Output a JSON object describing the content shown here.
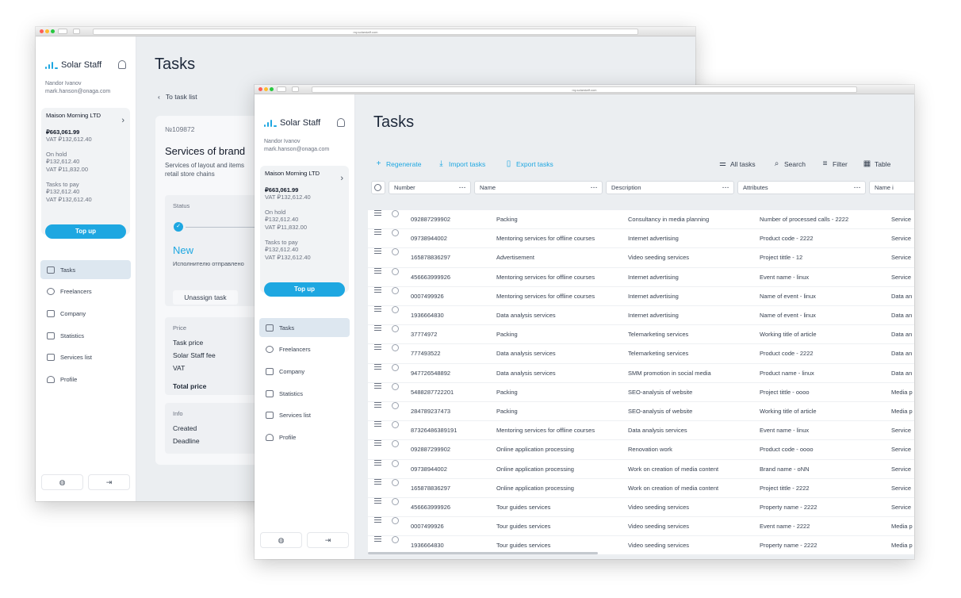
{
  "browser": {
    "url": "my.solarstaff.com"
  },
  "brand": {
    "name": "Solar Staff"
  },
  "user": {
    "name": "Nandor Ivanov",
    "email": "mark.hanson@onaga.com"
  },
  "account": {
    "company": "Maison Morning LTD",
    "balance": "₽663,061.99",
    "balance_vat": "VAT ₽132,612.40",
    "on_hold_label": "On hold",
    "on_hold": "₽132,612.40",
    "on_hold_vat": "VAT ₽11,832.00",
    "tasks_to_pay_label": "Tasks to pay",
    "tasks_to_pay": "₽132,612.40",
    "tasks_to_pay_vat": "VAT ₽132,612.40",
    "topup_label": "Top up"
  },
  "nav": [
    {
      "label": "Tasks",
      "icon": "briefcase-icon"
    },
    {
      "label": "Freelancers",
      "icon": "users-icon"
    },
    {
      "label": "Company",
      "icon": "bar-chart-icon"
    },
    {
      "label": "Statistics",
      "icon": "clipboard-icon"
    },
    {
      "label": "Services list",
      "icon": "trend-icon"
    },
    {
      "label": "Profile",
      "icon": "person-icon"
    }
  ],
  "footer": {
    "globe": "◍",
    "logout": "⇥"
  },
  "page_title": "Tasks",
  "detail": {
    "back_label": "To task list",
    "task_number": "№109872",
    "service_title": "Services of brand",
    "service_desc": "Services of layout and items retail store chains",
    "status_header": "Status",
    "status_value": "New",
    "status_desc": "Исполнителю отправлено",
    "unassign_label": "Unassign task",
    "price_header": "Price",
    "task_price": "Task price",
    "fee": "Solar Staff fee",
    "vat": "VAT",
    "total": "Total price",
    "info_header": "Info",
    "created": "Created",
    "deadline": "Deadline"
  },
  "toolbar": {
    "regenerate": "Regenerate",
    "import": "Import tasks",
    "export": "Export tasks",
    "all_tasks": "All tasks",
    "search": "Search",
    "filter": "Filter",
    "table": "Table"
  },
  "columns": [
    "Number",
    "Name",
    "Description",
    "Attributes",
    "Name i"
  ],
  "rows": [
    [
      "092887299902",
      "Packing",
      "Consultancy in media planning",
      "Number of processed calls - 2222",
      "Service"
    ],
    [
      "09738944002",
      "Mentoring services for offline courses",
      "Internet advertising",
      "Product code - 2222",
      "Service"
    ],
    [
      "165878836297",
      "Advertisement",
      "Video seeding services",
      "Project tittle - 12",
      "Service"
    ],
    [
      "456663999926",
      "Mentoring services for offline courses",
      "Internet advertising",
      "Event name - linux",
      "Service"
    ],
    [
      "0007499926",
      "Mentoring services for offline courses",
      "Internet advertising",
      "Name of event - linux",
      "Data an"
    ],
    [
      "1936664830",
      "Data analysis services",
      "Internet advertising",
      "Name of event - linux",
      "Data an"
    ],
    [
      "37774972",
      "Packing",
      "Telemarketing services",
      "Working title of article",
      "Data an"
    ],
    [
      "777493522",
      "Data analysis services",
      "Telemarketing services",
      "Product code - 2222",
      "Data an"
    ],
    [
      "947726548892",
      "Data analysis services",
      "SMM promotion in social media",
      "Product name - linux",
      "Data an"
    ],
    [
      "5488287722201",
      "Packing",
      "SEO-analysis of website",
      "Project tittle - oooo",
      "Media p"
    ],
    [
      "284789237473",
      "Packing",
      "SEO-analysis of website",
      "Working title of article",
      "Media p"
    ],
    [
      "87326486389191",
      "Mentoring services for offline courses",
      "Data analysis services",
      "Event name - linux",
      "Service"
    ],
    [
      "092887299902",
      "Online application processing",
      "Renovation work",
      "Product code - oooo",
      "Service"
    ],
    [
      "09738944002",
      "Online application processing",
      "Work on creation of media content",
      "Brand name - oNN",
      "Service"
    ],
    [
      "165878836297",
      "Online application processing",
      "Work on creation of media content",
      "Project tittle - 2222",
      "Service"
    ],
    [
      "456663999926",
      "Tour guides services",
      "Video seeding services",
      "Property name - 2222",
      "Service"
    ],
    [
      "0007499926",
      "Tour guides services",
      "Video seeding services",
      "Event name - 2222",
      "Media p"
    ],
    [
      "1936664830",
      "Tour guides services",
      "Video seeding services",
      "Property name - 2222",
      "Media p"
    ]
  ],
  "colors": {
    "accent": "#1ea7e1",
    "background": "#ebeef1",
    "sidebar": "#ffffff"
  }
}
